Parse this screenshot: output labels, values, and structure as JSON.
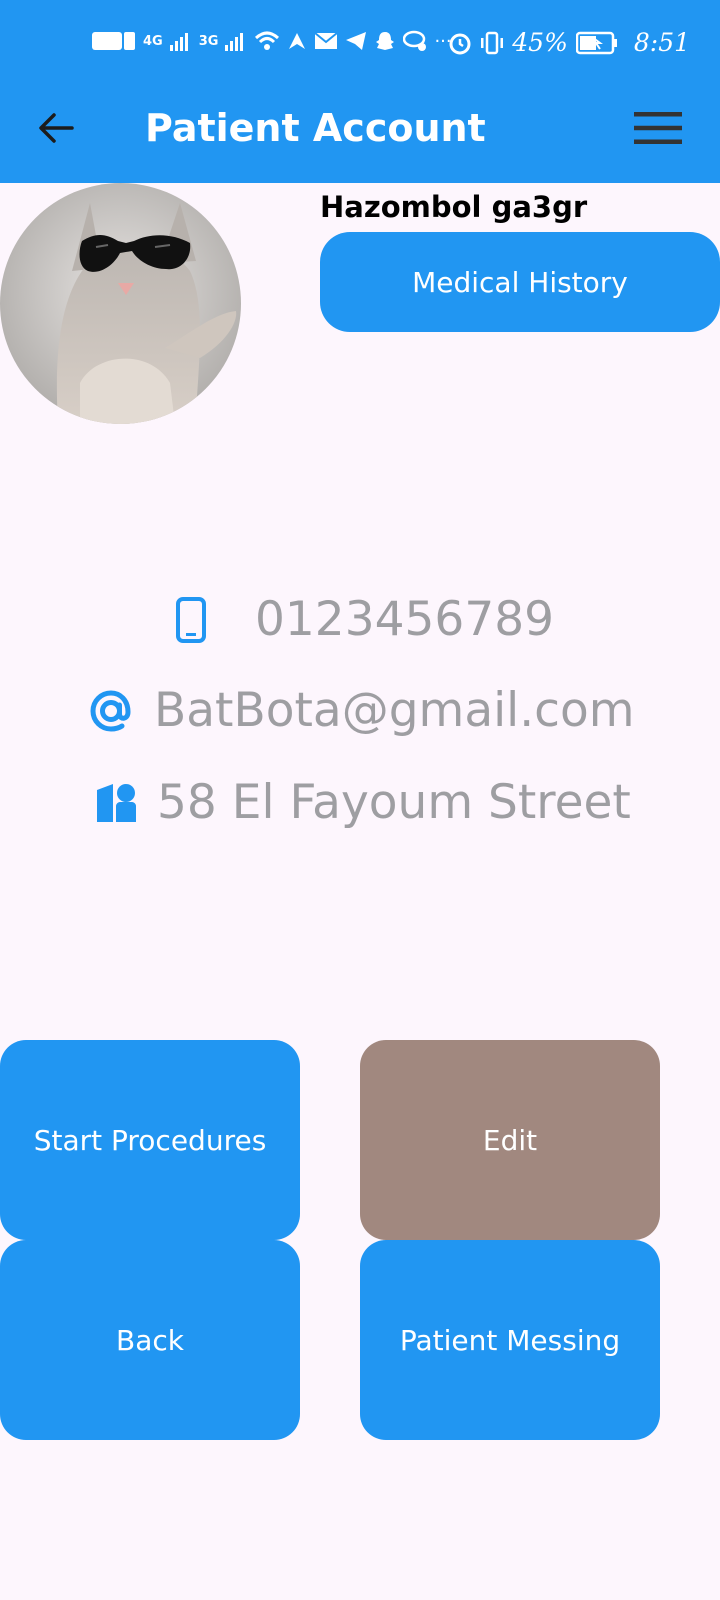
{
  "status_bar": {
    "net_4g": "4G",
    "net_3g": "3G",
    "battery": "45%",
    "time": "8:51",
    "overflow": "···"
  },
  "app_bar": {
    "title": "Patient Account"
  },
  "profile": {
    "name": "Hazombol ga3gr",
    "medical_history_label": "Medical History"
  },
  "contact": {
    "phone": "0123456789",
    "email": "BatBota@gmail.com",
    "address": "58 El Fayoum Street"
  },
  "actions": {
    "start_procedures": "Start Procedures",
    "edit": "Edit",
    "back": "Back",
    "patient_messing": "Patient Messing"
  },
  "colors": {
    "primary": "#2196F2",
    "edit_button": "#A1887F",
    "background": "#FDF6FD",
    "muted_text": "#9E9EA2"
  },
  "icons": {
    "back": "arrow-left-icon",
    "menu": "hamburger-menu-icon",
    "phone": "phone-icon",
    "email": "at-sign-icon",
    "address": "location-icon"
  }
}
